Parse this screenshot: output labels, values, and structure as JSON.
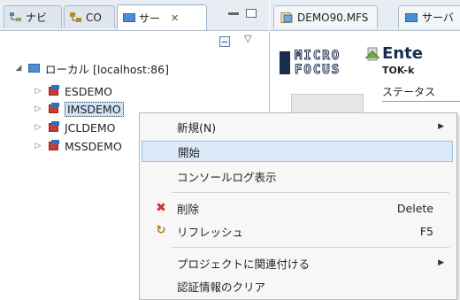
{
  "left_tabs": [
    {
      "label": "ナビ",
      "icon": "navigator-icon"
    },
    {
      "label": "CO",
      "icon": "package-explorer-icon"
    },
    {
      "label": "サー",
      "icon": "server-icon"
    }
  ],
  "tree": {
    "root": {
      "label": "ローカル [localhost:86]",
      "icon": "server-icon"
    },
    "regions": [
      {
        "label": "ESDEMO"
      },
      {
        "label": "IMSDEMO"
      },
      {
        "label": "JCLDEMO"
      },
      {
        "label": "MSSDEMO"
      }
    ]
  },
  "right_tabs": [
    {
      "label": "DEMO90.MFS",
      "icon": "file-icon"
    },
    {
      "label": "サーバ",
      "icon": "server-icon"
    }
  ],
  "editor": {
    "logo_line1": "MICRO",
    "logo_line2": "FOCUS",
    "title": "Ente",
    "host": "TOK-k",
    "status_label": "ステータス"
  },
  "context_menu": {
    "items": [
      {
        "label": "新規(N)",
        "submenu": true
      },
      {
        "label": "開始",
        "highlighted": true
      },
      {
        "label": "コンソールログ表示"
      },
      {
        "label": "削除",
        "accelerator": "Delete",
        "icon": "delete-icon"
      },
      {
        "label": "リフレッシュ",
        "accelerator": "F5",
        "icon": "refresh-icon"
      },
      {
        "label": "プロジェクトに関連付ける",
        "submenu": true
      },
      {
        "label": "認証情報のクリア"
      }
    ]
  },
  "colors": {
    "highlight_bg": "#dbe9f8",
    "delete_red": "#d93030",
    "brand_navy": "#1a2c4d"
  }
}
